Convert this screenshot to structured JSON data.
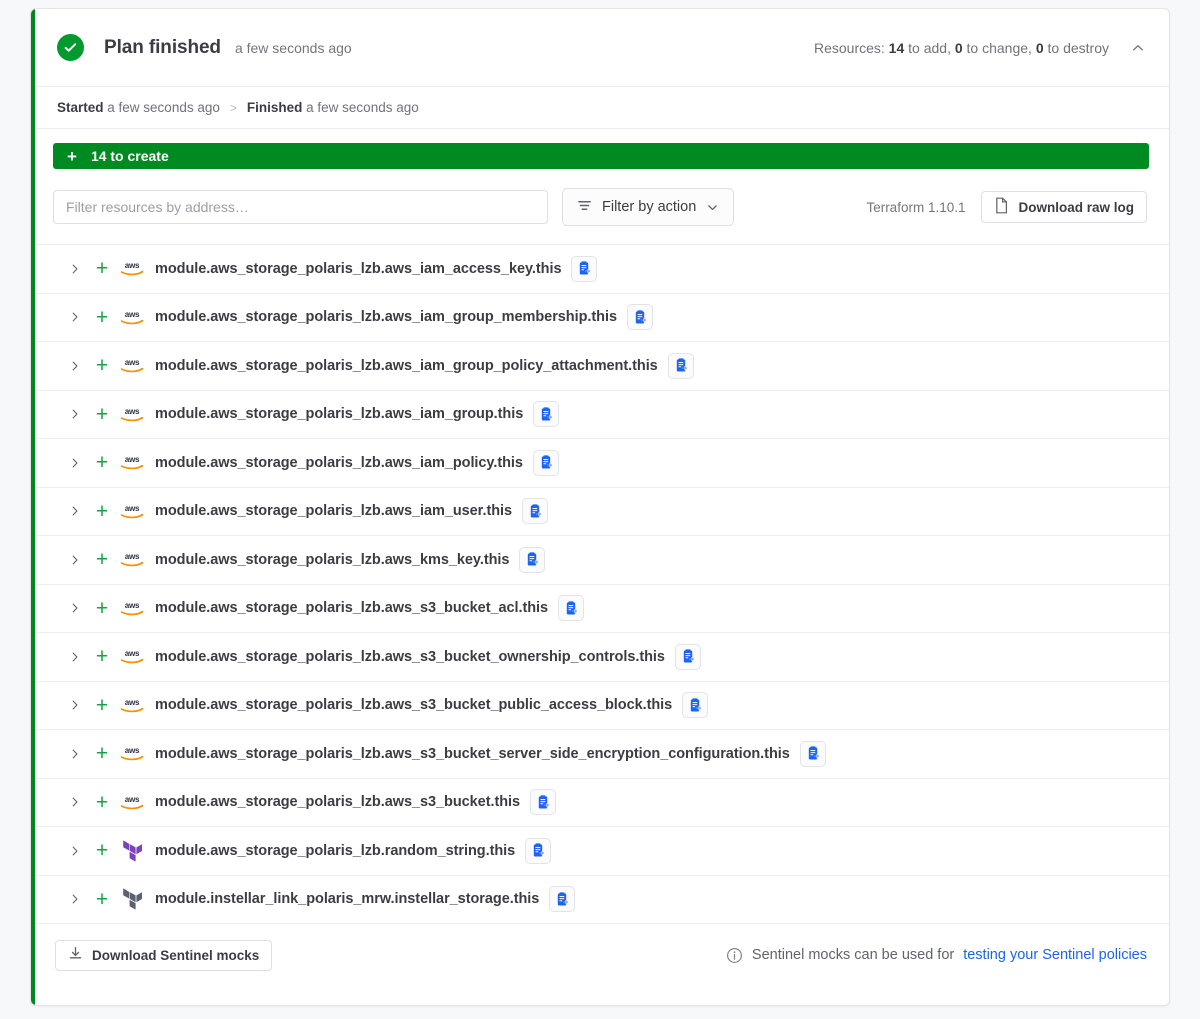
{
  "header": {
    "status_icon": "check-circle-icon",
    "title": "Plan finished",
    "time": "a few seconds ago",
    "resources_prefix": "Resources:",
    "to_add": "14",
    "to_add_label": "to add,",
    "to_change": "0",
    "to_change_label": "to change,",
    "to_destroy": "0",
    "to_destroy_label": "to destroy",
    "collapse_icon": "chevron-up-icon"
  },
  "timeline": {
    "started_label": "Started",
    "started_value": "a few seconds ago",
    "separator": ">",
    "finished_label": "Finished",
    "finished_value": "a few seconds ago"
  },
  "create_bar": {
    "plus": "+",
    "label": "14 to create",
    "color": "#008a22",
    "count": 14
  },
  "toolbar": {
    "filter_placeholder": "Filter resources by address…",
    "filter_value": "",
    "filter_by_action_label": "Filter by action",
    "filter_icon": "filter-icon",
    "chevron_icon": "chevron-down-icon",
    "terraform_version": "Terraform 1.10.1",
    "download_raw_log_label": "Download raw log",
    "download_raw_log_icon": "file-icon"
  },
  "resources": [
    {
      "action": "create",
      "action_symbol": "+",
      "provider": "aws",
      "address": "module.aws_storage_polaris_lzb.aws_iam_access_key.this"
    },
    {
      "action": "create",
      "action_symbol": "+",
      "provider": "aws",
      "address": "module.aws_storage_polaris_lzb.aws_iam_group_membership.this"
    },
    {
      "action": "create",
      "action_symbol": "+",
      "provider": "aws",
      "address": "module.aws_storage_polaris_lzb.aws_iam_group_policy_attachment.this"
    },
    {
      "action": "create",
      "action_symbol": "+",
      "provider": "aws",
      "address": "module.aws_storage_polaris_lzb.aws_iam_group.this"
    },
    {
      "action": "create",
      "action_symbol": "+",
      "provider": "aws",
      "address": "module.aws_storage_polaris_lzb.aws_iam_policy.this"
    },
    {
      "action": "create",
      "action_symbol": "+",
      "provider": "aws",
      "address": "module.aws_storage_polaris_lzb.aws_iam_user.this"
    },
    {
      "action": "create",
      "action_symbol": "+",
      "provider": "aws",
      "address": "module.aws_storage_polaris_lzb.aws_kms_key.this"
    },
    {
      "action": "create",
      "action_symbol": "+",
      "provider": "aws",
      "address": "module.aws_storage_polaris_lzb.aws_s3_bucket_acl.this"
    },
    {
      "action": "create",
      "action_symbol": "+",
      "provider": "aws",
      "address": "module.aws_storage_polaris_lzb.aws_s3_bucket_ownership_controls.this"
    },
    {
      "action": "create",
      "action_symbol": "+",
      "provider": "aws",
      "address": "module.aws_storage_polaris_lzb.aws_s3_bucket_public_access_block.this"
    },
    {
      "action": "create",
      "action_symbol": "+",
      "provider": "aws",
      "address": "module.aws_storage_polaris_lzb.aws_s3_bucket_server_side_encryption_configuration.this"
    },
    {
      "action": "create",
      "action_symbol": "+",
      "provider": "aws",
      "address": "module.aws_storage_polaris_lzb.aws_s3_bucket.this"
    },
    {
      "action": "create",
      "action_symbol": "+",
      "provider": "terraform-purple",
      "address": "module.aws_storage_polaris_lzb.random_string.this"
    },
    {
      "action": "create",
      "action_symbol": "+",
      "provider": "terraform-gray",
      "address": "module.instellar_link_polaris_mrw.instellar_storage.this"
    }
  ],
  "row_icons": {
    "expand_icon": "chevron-right-icon",
    "copy_icon": "copy-to-clipboard-icon"
  },
  "footer": {
    "download_mocks_label": "Download Sentinel mocks",
    "download_mocks_icon": "download-icon",
    "info_icon": "info-icon",
    "note_text": "Sentinel mocks can be used for",
    "note_link": "testing your Sentinel policies"
  },
  "colors": {
    "success": "#009a2e",
    "create": "#008a22",
    "plus": "#17a33f",
    "link": "#1c64f2",
    "aws_orange": "#f79000",
    "terraform_purple": "#7b42bc",
    "terraform_gray": "#5c6171"
  }
}
